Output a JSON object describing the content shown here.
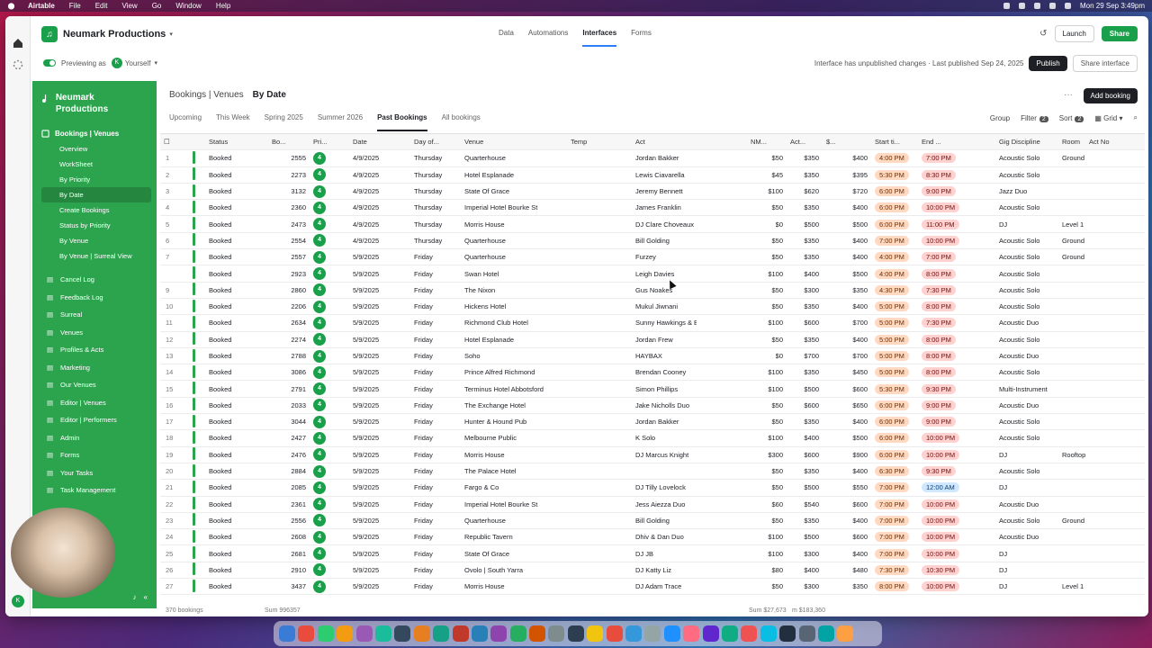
{
  "menubar": {
    "app": "Airtable",
    "items": [
      "File",
      "Edit",
      "View",
      "Go",
      "Window",
      "Help"
    ],
    "datetime": "Mon 29 Sep  3:49pm"
  },
  "top": {
    "base_name": "Neumark Productions",
    "nav": [
      "Data",
      "Automations",
      "Interfaces",
      "Forms"
    ],
    "active_nav": "Interfaces",
    "launch": "Launch",
    "share": "Share"
  },
  "preview": {
    "label": "Previewing as",
    "user_initial": "K",
    "user": "Yourself",
    "status": "Interface has unpublished changes · Last published Sep 24, 2025",
    "publish": "Publish",
    "share_interface": "Share interface"
  },
  "sidebar": {
    "title": "Neumark Productions",
    "section": "Bookings | Venues",
    "sub_items": [
      "Overview",
      "WorkSheet",
      "By Priority",
      "By Date",
      "Create Bookings",
      "Status by Priority",
      "By Venue",
      "By Venue | Surreal View"
    ],
    "active_sub": "By Date",
    "items": [
      "Cancel Log",
      "Feedback Log",
      "Surreal",
      "Venues",
      "Profiles & Acts",
      "Marketing",
      "Our Venues",
      "Editor | Venues",
      "Editor | Performers",
      "Admin",
      "Forms",
      "Your Tasks",
      "Task Management"
    ]
  },
  "main": {
    "crumb_parent": "Bookings | Venues",
    "crumb_current": "By Date",
    "add_button": "Add booking",
    "tabs": [
      "Upcoming",
      "This Week",
      "Spring 2025",
      "Summer 2026",
      "Past Bookings",
      "All bookings"
    ],
    "active_tab": "Past Bookings",
    "toolbar": {
      "group": "Group",
      "filter": "Filter",
      "filter_count": "2",
      "sort": "Sort",
      "sort_count": "2",
      "grid": "Grid"
    }
  },
  "table": {
    "columns": [
      "Status",
      "Bo...",
      "Pri...",
      "Date",
      "Day of...",
      "Venue",
      "Temp",
      "Act",
      "",
      "NM...",
      "Act...",
      "$...",
      "Start ti...",
      "End ...",
      "Gig Discipline",
      "Room",
      "Act No"
    ],
    "rows": [
      [
        "1",
        "Booked",
        "2555",
        "4",
        "4/9/2025",
        "Thursday",
        "Quarterhouse",
        "",
        "Jordan Bakker",
        "$50",
        "$350",
        "$400",
        "4:00 PM",
        "7:00 PM",
        "Acoustic Solo",
        "Ground Floor"
      ],
      [
        "2",
        "Booked",
        "2273",
        "4",
        "4/9/2025",
        "Thursday",
        "Hotel Esplanade",
        "",
        "Lewis Ciavarella",
        "$45",
        "$350",
        "$395",
        "5:30 PM",
        "8:30 PM",
        "Acoustic Solo",
        ""
      ],
      [
        "3",
        "Booked",
        "3132",
        "4",
        "4/9/2025",
        "Thursday",
        "State Of Grace",
        "",
        "Jeremy Bennett",
        "$100",
        "$620",
        "$720",
        "6:00 PM",
        "9:00 PM",
        "Jazz Duo",
        ""
      ],
      [
        "4",
        "Booked",
        "2360",
        "4",
        "4/9/2025",
        "Thursday",
        "Imperial Hotel Bourke St",
        "",
        "James Franklin",
        "$50",
        "$350",
        "$400",
        "6:00 PM",
        "10:00 PM",
        "Acoustic Solo",
        ""
      ],
      [
        "5",
        "Booked",
        "2473",
        "4",
        "4/9/2025",
        "Thursday",
        "Morris House",
        "",
        "DJ Clare Choveaux",
        "$0",
        "$500",
        "$500",
        "6:00 PM",
        "11:00 PM",
        "DJ",
        "Level 1"
      ],
      [
        "6",
        "Booked",
        "2554",
        "4",
        "4/9/2025",
        "Thursday",
        "Quarterhouse",
        "",
        "Bill Golding",
        "$50",
        "$350",
        "$400",
        "7:00 PM",
        "10:00 PM",
        "Acoustic Solo",
        "Ground Floor"
      ],
      [
        "7",
        "Booked",
        "2557",
        "4",
        "5/9/2025",
        "Friday",
        "Quarterhouse",
        "",
        "Furzey",
        "$50",
        "$350",
        "$400",
        "4:00 PM",
        "7:00 PM",
        "Acoustic Solo",
        "Ground Floor"
      ],
      [
        "",
        "Booked",
        "2923",
        "4",
        "5/9/2025",
        "Friday",
        "Swan Hotel",
        "",
        "Leigh Davies",
        "$100",
        "$400",
        "$500",
        "4:00 PM",
        "8:00 PM",
        "Acoustic Solo",
        ""
      ],
      [
        "9",
        "Booked",
        "2860",
        "4",
        "5/9/2025",
        "Friday",
        "The Nixon",
        "",
        "Gus Noakes",
        "$50",
        "$300",
        "$350",
        "4:30 PM",
        "7:30 PM",
        "Acoustic Solo",
        ""
      ],
      [
        "10",
        "Booked",
        "2206",
        "4",
        "5/9/2025",
        "Friday",
        "Hickens Hotel",
        "",
        "Mukul Jiwnani",
        "$50",
        "$350",
        "$400",
        "5:00 PM",
        "8:00 PM",
        "Acoustic Solo",
        ""
      ],
      [
        "11",
        "Booked",
        "2634",
        "4",
        "5/9/2025",
        "Friday",
        "Richmond Club Hotel",
        "",
        "Sunny Hawkings & Bobi",
        "$100",
        "$600",
        "$700",
        "5:00 PM",
        "7:30 PM",
        "Acoustic Duo",
        ""
      ],
      [
        "12",
        "Booked",
        "2274",
        "4",
        "5/9/2025",
        "Friday",
        "Hotel Esplanade",
        "",
        "Jordan Frew",
        "$50",
        "$350",
        "$400",
        "5:00 PM",
        "8:00 PM",
        "Acoustic Solo",
        ""
      ],
      [
        "13",
        "Booked",
        "2788",
        "4",
        "5/9/2025",
        "Friday",
        "Soho",
        "",
        "HAYBAX",
        "$0",
        "$700",
        "$700",
        "5:00 PM",
        "8:00 PM",
        "Acoustic Duo",
        ""
      ],
      [
        "14",
        "Booked",
        "3086",
        "4",
        "5/9/2025",
        "Friday",
        "Prince Alfred Richmond",
        "",
        "Brendan Cooney",
        "$100",
        "$350",
        "$450",
        "5:00 PM",
        "8:00 PM",
        "Acoustic Solo",
        ""
      ],
      [
        "15",
        "Booked",
        "2791",
        "4",
        "5/9/2025",
        "Friday",
        "Terminus Hotel Abbotsford",
        "",
        "Simon Phillips",
        "$100",
        "$500",
        "$600",
        "5:30 PM",
        "9:30 PM",
        "Multi-Instrument",
        ""
      ],
      [
        "16",
        "Booked",
        "2033",
        "4",
        "5/9/2025",
        "Friday",
        "The Exchange Hotel",
        "",
        "Jake Nicholls Duo",
        "$50",
        "$600",
        "$650",
        "6:00 PM",
        "9:00 PM",
        "Acoustic Duo",
        ""
      ],
      [
        "17",
        "Booked",
        "3044",
        "4",
        "5/9/2025",
        "Friday",
        "Hunter & Hound Pub",
        "",
        "Jordan Bakker",
        "$50",
        "$350",
        "$400",
        "6:00 PM",
        "9:00 PM",
        "Acoustic Solo",
        ""
      ],
      [
        "18",
        "Booked",
        "2427",
        "4",
        "5/9/2025",
        "Friday",
        "Melbourne Public",
        "",
        "K Solo",
        "$100",
        "$400",
        "$500",
        "6:00 PM",
        "10:00 PM",
        "Acoustic Solo",
        ""
      ],
      [
        "19",
        "Booked",
        "2476",
        "4",
        "5/9/2025",
        "Friday",
        "Morris House",
        "",
        "DJ Marcus Knight",
        "$300",
        "$600",
        "$900",
        "6:00 PM",
        "10:00 PM",
        "DJ",
        "Rooftop"
      ],
      [
        "20",
        "Booked",
        "2884",
        "4",
        "5/9/2025",
        "Friday",
        "The Palace Hotel",
        "",
        "",
        "$50",
        "$350",
        "$400",
        "6:30 PM",
        "9:30 PM",
        "Acoustic Solo",
        ""
      ],
      [
        "21",
        "Booked",
        "2085",
        "4",
        "5/9/2025",
        "Friday",
        "Fargo & Co",
        "",
        "DJ Tilly Lovelock",
        "$50",
        "$500",
        "$550",
        "7:00 PM",
        "12:00 AM",
        "DJ",
        ""
      ],
      [
        "22",
        "Booked",
        "2361",
        "4",
        "5/9/2025",
        "Friday",
        "Imperial Hotel Bourke St",
        "",
        "Jess Aiezza Duo",
        "$60",
        "$540",
        "$600",
        "7:00 PM",
        "10:00 PM",
        "Acoustic Duo",
        ""
      ],
      [
        "23",
        "Booked",
        "2556",
        "4",
        "5/9/2025",
        "Friday",
        "Quarterhouse",
        "",
        "Bill Golding",
        "$50",
        "$350",
        "$400",
        "7:00 PM",
        "10:00 PM",
        "Acoustic Solo",
        "Ground Floor"
      ],
      [
        "24",
        "Booked",
        "2608",
        "4",
        "5/9/2025",
        "Friday",
        "Republic Tavern",
        "",
        "Dhiv & Dan Duo",
        "$100",
        "$500",
        "$600",
        "7:00 PM",
        "10:00 PM",
        "Acoustic Duo",
        ""
      ],
      [
        "25",
        "Booked",
        "2681",
        "4",
        "5/9/2025",
        "Friday",
        "State Of Grace",
        "",
        "DJ JB",
        "$100",
        "$300",
        "$400",
        "7:00 PM",
        "10:00 PM",
        "DJ",
        ""
      ],
      [
        "26",
        "Booked",
        "2910",
        "4",
        "5/9/2025",
        "Friday",
        "Ovolo | South Yarra",
        "",
        "DJ Katty Liz",
        "$80",
        "$400",
        "$480",
        "7:30 PM",
        "10:30 PM",
        "DJ",
        ""
      ],
      [
        "27",
        "Booked",
        "3437",
        "4",
        "5/9/2025",
        "Friday",
        "Morris House",
        "",
        "DJ Adam Trace",
        "$50",
        "$300",
        "$350",
        "8:00 PM",
        "10:00 PM",
        "DJ",
        "Level 1"
      ]
    ],
    "footer_count": "370 bookings",
    "footer_sum1": "Sum 996357",
    "footer_sum2": "Sum $27,673",
    "footer_sum3": "m $183,360"
  }
}
